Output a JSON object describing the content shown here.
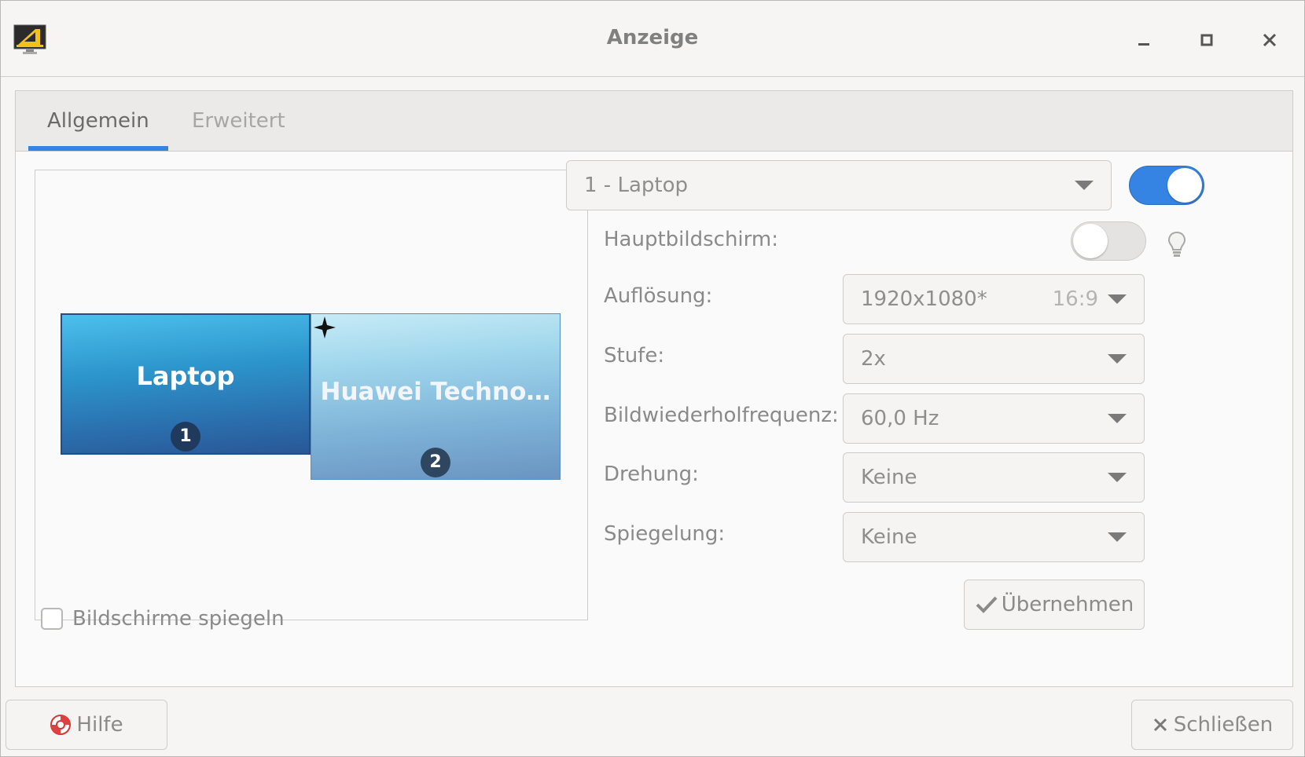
{
  "window": {
    "title": "Anzeige",
    "app_icon": "display-settings-icon",
    "controls": [
      "minimize-icon",
      "maximize-icon",
      "close-icon"
    ]
  },
  "tabs": [
    {
      "label": "Allgemein",
      "active": true
    },
    {
      "label": "Erweitert",
      "active": false
    }
  ],
  "preview": {
    "monitors": [
      {
        "name": "Laptop",
        "number": "1",
        "selected": true,
        "primary_marker": true
      },
      {
        "name": "Huawei Techno…",
        "number": "2",
        "selected": false
      }
    ],
    "mirror_label": "Bildschirme spiegeln",
    "mirror_checked": false
  },
  "settings": {
    "monitor_select": "1 - Laptop",
    "monitor_enabled": true,
    "primary_label": "Hauptbildschirm:",
    "primary_enabled": false,
    "primary_icon": "lightbulb-icon",
    "resolution_label": "Auflösung:",
    "resolution_value": "1920x1080*",
    "resolution_aspect": "16:9",
    "scale_label": "Stufe:",
    "scale_value": "2x",
    "refresh_label": "Bildwiederholfrequenz:",
    "refresh_value": "60,0 Hz",
    "rotation_label": "Drehung:",
    "rotation_value": "Keine",
    "reflection_label": "Spiegelung:",
    "reflection_value": "Keine",
    "apply_label": "Übernehmen",
    "apply_icon": "checkmark-icon"
  },
  "footer": {
    "help_label": "Hilfe",
    "help_icon": "lifebuoy-icon",
    "close_label": "Schließen",
    "close_icon": "close-x-icon"
  },
  "colors": {
    "accent": "#3584e4",
    "window_bg": "#f6f5f4",
    "text": "#8a8a8a"
  }
}
